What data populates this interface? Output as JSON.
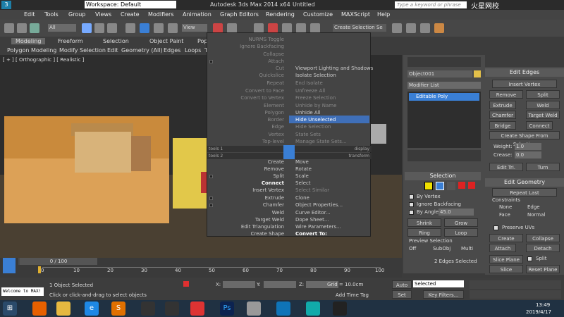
{
  "titlebar": {
    "workspace": "Workspace: Default",
    "app_title": "Autodesk 3ds Max  2014 x64",
    "doc_title": "Untitled",
    "search_placeholder": "Type a keyword or phrase",
    "watermark": "火星网校"
  },
  "menu": [
    "Edit",
    "Tools",
    "Group",
    "Views",
    "Create",
    "Modifiers",
    "Animation",
    "Graph Editors",
    "Rendering",
    "Customize",
    "MAXScript",
    "Help"
  ],
  "toolbar": {
    "filter": "All",
    "view": "View",
    "selection_set": "Create Selection Se"
  },
  "ribbon": {
    "tabs": [
      "Modeling",
      "Freeform",
      "Selection",
      "Object Paint",
      "Populate"
    ],
    "sub": [
      "Polygon Modeling",
      "Modify Selection",
      "Edit",
      "Geometry (All)",
      "Edges",
      "Loops",
      "T"
    ],
    "more": "ies"
  },
  "viewport": {
    "label": "[ + ] [ Orthographic ] [ Realistic ]"
  },
  "quadmenu": {
    "tl": [
      "NURMS Toggle",
      "Ignore Backfacing",
      "Collapse",
      "Attach",
      "Cut",
      "Quickslice",
      "Repeat",
      "Convert to Face",
      "Convert to Vertex",
      "Element",
      "Polygon",
      "Border",
      "Edge",
      "Vertex",
      "Top-level"
    ],
    "tr": [
      "Viewport Lighting and Shadows",
      "Isolate Selection",
      "End Isolate",
      "Unfreeze All",
      "Freeze Selection",
      "Unhide by Name",
      "Unhide All",
      "Hide Unselected",
      "Hide Selection",
      "State Sets",
      "Manage State Sets..."
    ],
    "bar1": [
      "tools 1",
      "display"
    ],
    "bar2": [
      "tools 2",
      "transform"
    ],
    "bl": [
      "Create",
      "Remove",
      "Split",
      "Connect",
      "Insert Vertex",
      "Extrude",
      "Chamfer",
      "Weld",
      "Target Weld",
      "Edit Triangulation",
      "Create Shape"
    ],
    "br": [
      "Move",
      "Rotate",
      "Scale",
      "Select",
      "Select Similar",
      "Clone",
      "Object Properties...",
      "Curve Editor...",
      "Dope Sheet...",
      "Wire Parameters...",
      "Convert To:"
    ]
  },
  "command": {
    "object_name": "Object001",
    "modifier_list": "Modifier List",
    "stack_item": "Editable Poly",
    "selection_title": "Selection",
    "by_vertex": "By Vertex",
    "ignore_backfacing": "Ignore Backfacing",
    "by_angle": "By Angle:",
    "angle_value": "45.0",
    "shrink": "Shrink",
    "grow": "Grow",
    "ring": "Ring",
    "loop": "Loop",
    "preview_title": "Preview Selection",
    "preview_opts": [
      "Off",
      "SubObj",
      "Multi"
    ],
    "status": "2 Edges Selected"
  },
  "edit_edges": {
    "title": "Edit Edges",
    "insert_vertex": "Insert Vertex",
    "remove": "Remove",
    "split": "Split",
    "extrude": "Extrude",
    "weld": "Weld",
    "chamfer": "Chamfer",
    "target_weld": "Target Weld",
    "bridge": "Bridge",
    "connect": "Connect",
    "create_shape": "Create Shape From Selection",
    "weight_label": "Weight:",
    "weight": "1.0",
    "crease_label": "Crease:",
    "crease": "0.0",
    "edit_tri": "Edit Tri.",
    "turn": "Turn"
  },
  "edit_geometry": {
    "title": "Edit Geometry",
    "repeat_last": "Repeat Last",
    "constraints": "Constraints",
    "none": "None",
    "edge": "Edge",
    "face": "Face",
    "normal": "Normal",
    "preserve_uvs": "Preserve UVs",
    "create": "Create",
    "collapse": "Collapse",
    "attach": "Attach",
    "detach": "Detach",
    "slice_plane": "Slice Plane",
    "split": "Split",
    "slice": "Slice",
    "reset_plane": "Reset Plane"
  },
  "timeline": {
    "frame": "0 / 100",
    "ticks": [
      "0",
      "10",
      "20",
      "30",
      "40",
      "50",
      "60",
      "70",
      "80",
      "90",
      "100"
    ]
  },
  "status": {
    "maxscript": "Welcome to MAX!",
    "selected": "1 Object Selected",
    "prompt": "Click or click-and-drag to select objects",
    "x": "X:",
    "y": "Y:",
    "z": "Z:",
    "grid": "Grid = 10.0cm",
    "add_time_tag": "Add Time Tag",
    "auto_key": "Auto Key",
    "selected_dd": "Selected",
    "set_key": "Set Key",
    "key_filters": "Key Filters..."
  },
  "taskbar": {
    "time": "13:49",
    "date": "2019/4/17"
  }
}
